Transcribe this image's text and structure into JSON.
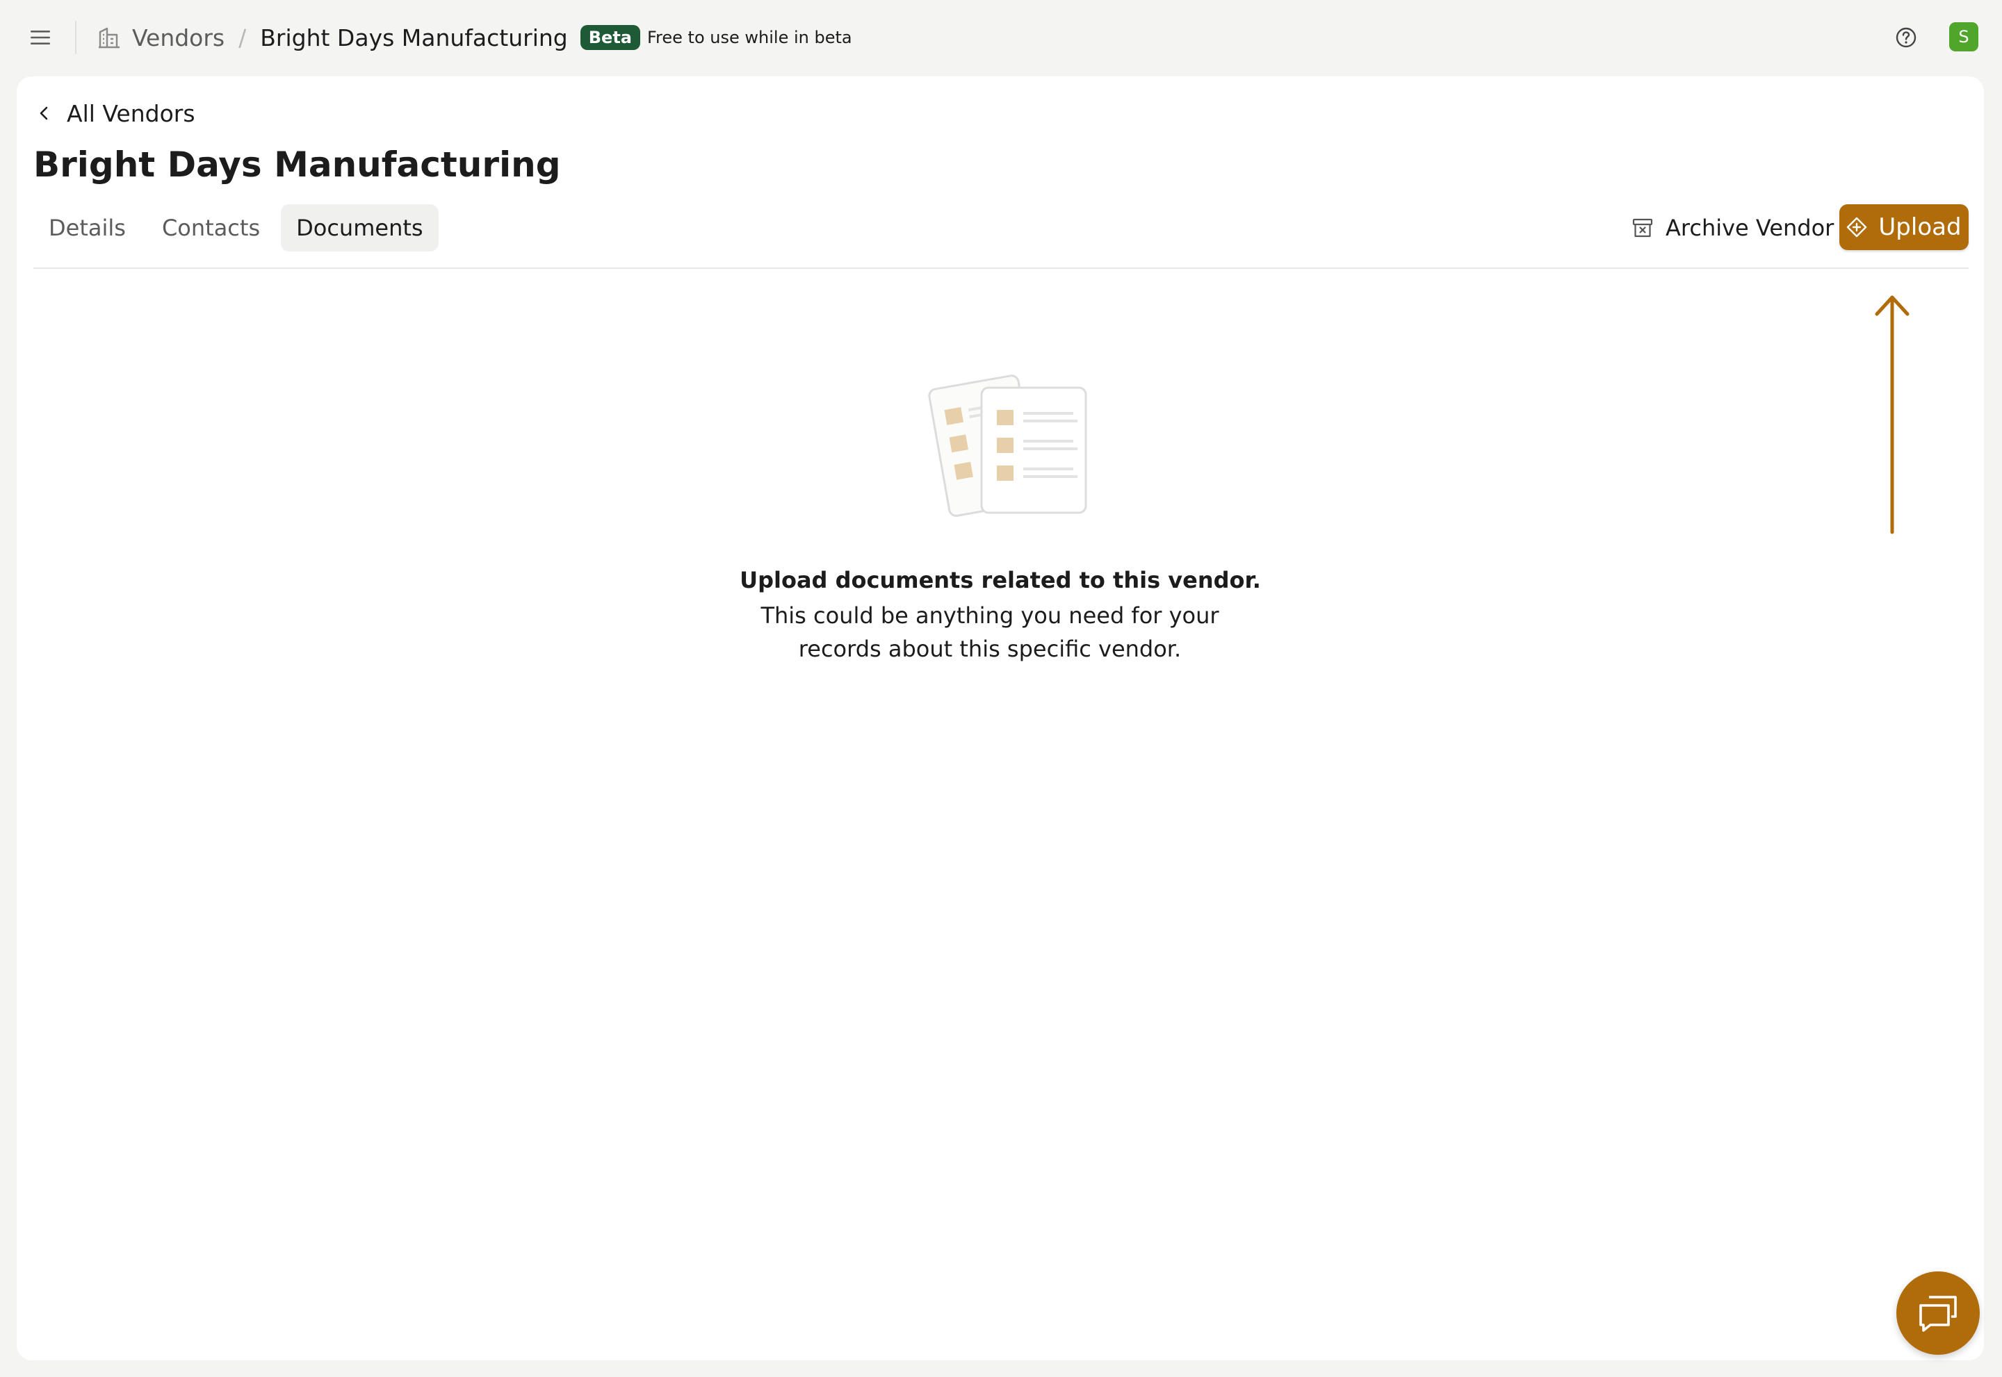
{
  "header": {
    "breadcrumb_root": "Vendors",
    "breadcrumb_separator": "/",
    "breadcrumb_current": "Bright Days Manufacturing",
    "beta_badge": "Beta",
    "beta_note": "Free to use while in beta",
    "avatar_initial": "S"
  },
  "page": {
    "back_label": "All Vendors",
    "title": "Bright Days Manufacturing",
    "tabs": [
      {
        "label": "Details",
        "active": false
      },
      {
        "label": "Contacts",
        "active": false
      },
      {
        "label": "Documents",
        "active": true
      }
    ],
    "archive_label": "Archive Vendor",
    "upload_label": "Upload"
  },
  "empty_state": {
    "heading": "Upload documents related to this vendor.",
    "body": "This could be anything you need for your records about this specific vendor."
  },
  "colors": {
    "accent": "#b06c0a",
    "beta_badge": "#1e5a36",
    "avatar": "#4fa62a",
    "illustration_fill": "#e6cfa9"
  },
  "icons": {
    "menu": "hamburger-icon",
    "vendors": "building-icon",
    "help": "help-circle-icon",
    "back": "chevron-left-icon",
    "archive": "archive-box-icon",
    "upload": "plus-diamond-icon",
    "chat": "chat-bubbles-icon"
  }
}
